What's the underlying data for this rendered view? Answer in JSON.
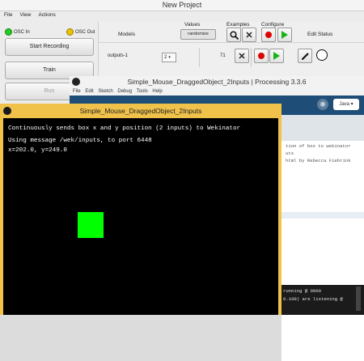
{
  "wekinator": {
    "title": "New Project",
    "menu": [
      "File",
      "View",
      "Actions"
    ],
    "osc_in_label": "OSC In",
    "osc_out_label": "OSC Out",
    "buttons": {
      "start_recording": "Start Recording",
      "train": "Train",
      "run": "Run"
    },
    "headers": {
      "models": "Models",
      "values": "Values",
      "examples": "Examples",
      "configure": "Configure",
      "edit": "Edit",
      "status": "Status"
    },
    "randomize_label": "randomize",
    "model_row": {
      "name": "outputs-1",
      "value": "2",
      "examples": "71"
    },
    "colors": {
      "osc_in": "#22cc22",
      "osc_out": "#e6c200"
    }
  },
  "processing": {
    "title": "Simple_Mouse_DraggedObject_2Inputs | Processing 3.3.6",
    "menu": [
      "File",
      "Edit",
      "Sketch",
      "Debug",
      "Tools",
      "Help"
    ],
    "mode": "Java ▾",
    "code_lines": [
      "tion of box to wekinator",
      "uts",
      "html by Rebecca Fiebrink"
    ],
    "console_lines": [
      "running @ 9000",
      "0.100) are listening @"
    ]
  },
  "sketch": {
    "title": "Simple_Mouse_DraggedObject_2Inputs",
    "line1": "Continuously sends box x and y position (2 inputs) to Wekinator",
    "line2": "Using message /wek/inputs, to port 6448",
    "line3": "x=202.0, y=249.0",
    "box_color": "#00ff00"
  }
}
